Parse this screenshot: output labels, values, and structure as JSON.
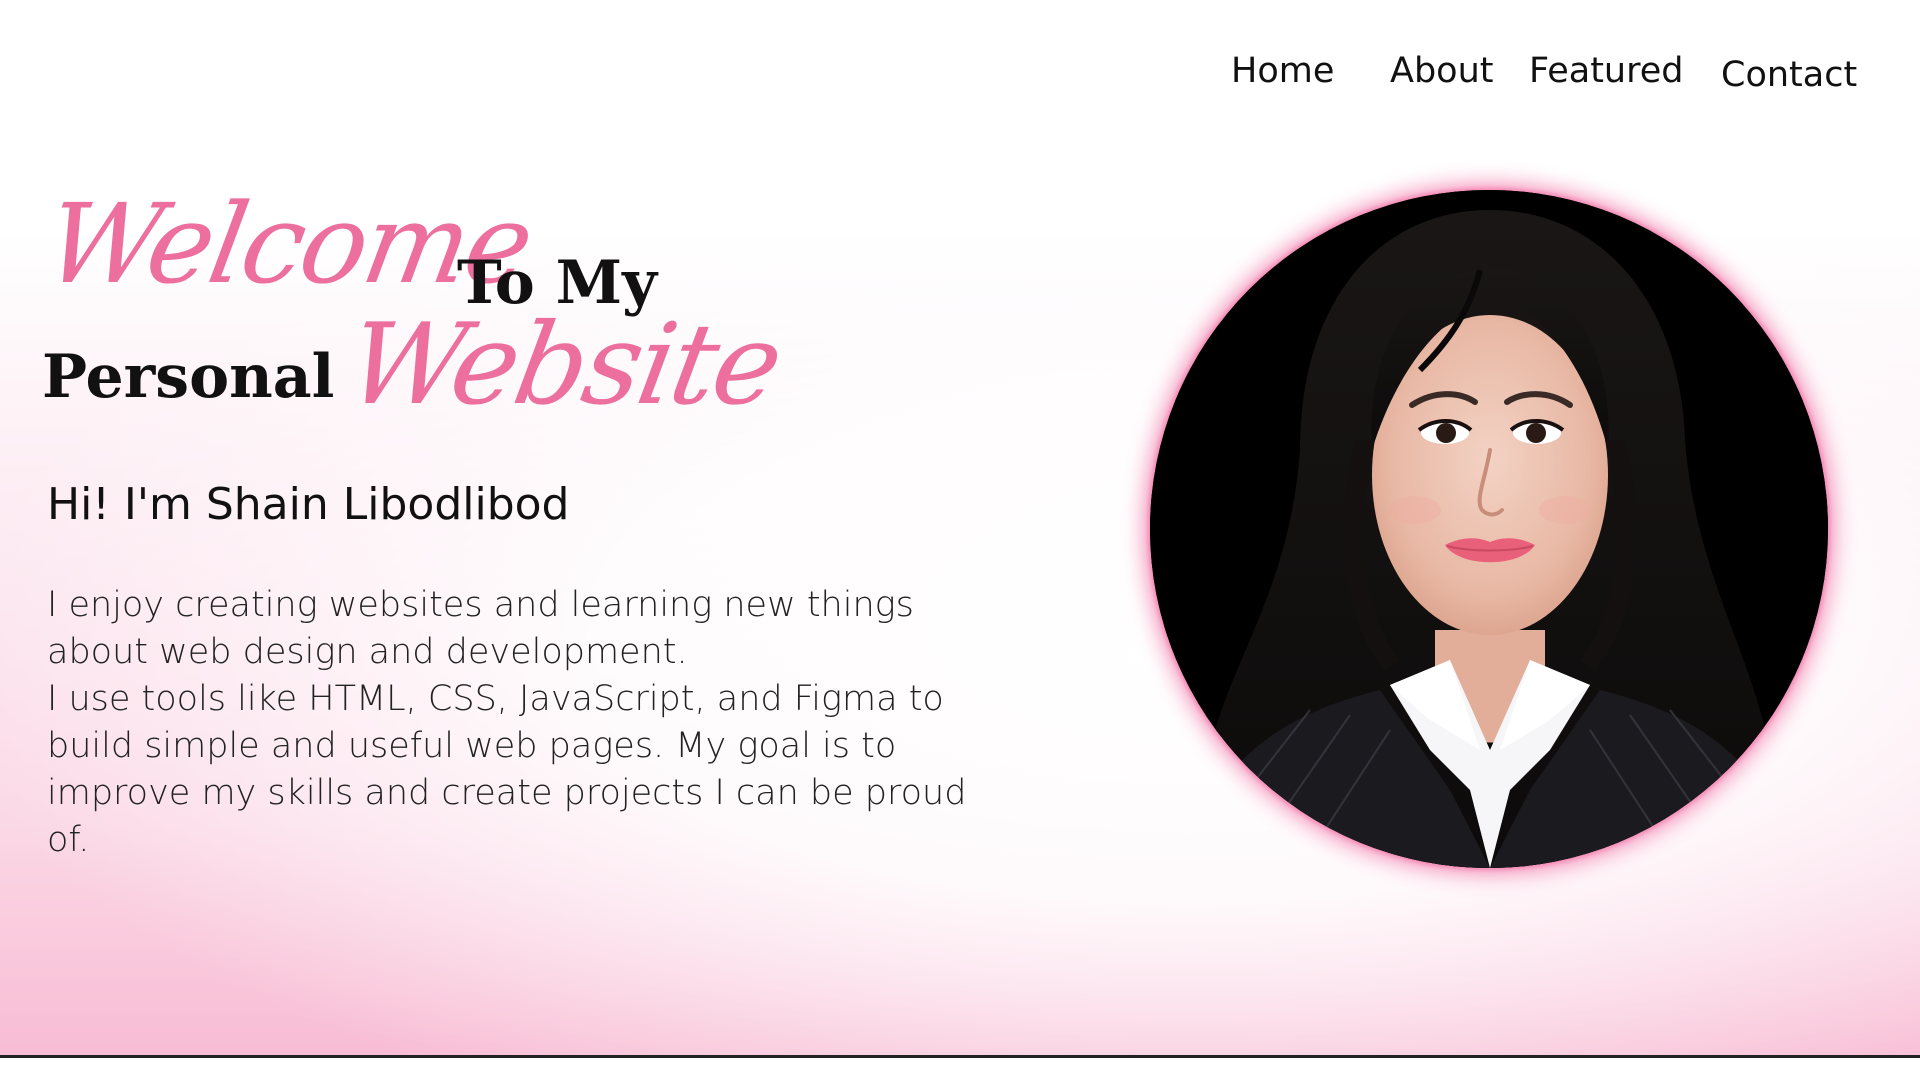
{
  "nav": {
    "items": [
      {
        "label": "Home"
      },
      {
        "label": "About"
      },
      {
        "label": "Featured"
      },
      {
        "label": "Contact"
      }
    ]
  },
  "hero": {
    "welcome": "Welcome",
    "to_my": "To My",
    "personal": "Personal",
    "website": "Website",
    "greeting": "Hi! I'm Shain Libodlibod",
    "intro_line1": " I enjoy creating websites and learning new things about web design and development.",
    "intro_line2": "I use tools like HTML, CSS, JavaScript, and Figma to build simple and useful web pages. My goal is to improve my skills and create projects I can be proud of."
  },
  "colors": {
    "accent": "#ec6f9e",
    "text": "#111111",
    "glow": "#f48fb8",
    "background_bottom": "#f8bcd4"
  }
}
